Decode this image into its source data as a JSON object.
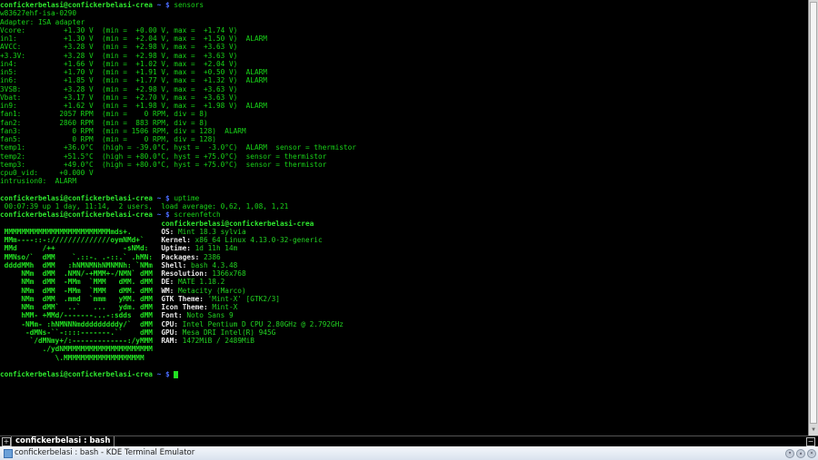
{
  "prompt": {
    "user_host": "confickerbelasi@confickerbelasi-crea",
    "tilde_dollar": " ~ $ "
  },
  "commands": [
    "sensors",
    "uptime",
    "screenfetch"
  ],
  "sensors_output": [
    "w83627ehf-isa-0290",
    "Adapter: ISA adapter",
    "Vcore:         +1.30 V  (min =  +0.00 V, max =  +1.74 V)",
    "in1:           +1.30 V  (min =  +2.04 V, max =  +1.50 V)  ALARM",
    "AVCC:          +3.28 V  (min =  +2.98 V, max =  +3.63 V)",
    "+3.3V:         +3.28 V  (min =  +2.98 V, max =  +3.63 V)",
    "in4:           +1.66 V  (min =  +1.02 V, max =  +2.04 V)",
    "in5:           +1.70 V  (min =  +1.91 V, max =  +0.50 V)  ALARM",
    "in6:           +1.85 V  (min =  +1.77 V, max =  +1.32 V)  ALARM",
    "3VSB:          +3.28 V  (min =  +2.98 V, max =  +3.63 V)",
    "Vbat:          +3.17 V  (min =  +2.70 V, max =  +3.63 V)",
    "in9:           +1.62 V  (min =  +1.98 V, max =  +1.98 V)  ALARM",
    "fan1:         2057 RPM  (min =    0 RPM, div = 8)",
    "fan2:         2860 RPM  (min =  883 RPM, div = 8)",
    "fan3:            0 RPM  (min = 1506 RPM, div = 128)  ALARM",
    "fan5:            0 RPM  (min =    0 RPM, div = 128)",
    "temp1:         +36.0°C  (high = -39.0°C, hyst =  -3.0°C)  ALARM  sensor = thermistor",
    "temp2:         +51.5°C  (high = +80.0°C, hyst = +75.0°C)  sensor = thermistor",
    "temp3:         +49.0°C  (high = +80.0°C, hyst = +75.0°C)  sensor = thermistor",
    "cpu0_vid:     +0.000 V",
    "intrusion0:  ALARM",
    ""
  ],
  "uptime_output": " 00:07:39 up 1 day, 11:14,  2 users,  load average: 0,62, 1,08, 1,21",
  "screenfetch": {
    "art": [
      "                                    ",
      " MMMMMMMMMMMMMMMMMMMMMMMMMmds+.     ",
      " MMm----::-://////////////oymNMd+`  ",
      " MMd      /++                -sNMd: ",
      " MMNso/`  dMM    `.::-. .-::.` .hMN:",
      " ddddMMh  dMM   :hNMNMNhNMNMNh: `NMm",
      "     NMm  dMM  .NMN/-+MMM+-/NMN` dMM",
      "     NMm  dMM  -MMm  `MMM   dMM. dMM",
      "     NMm  dMM  -MMm  `MMM   dMM. dMM",
      "     NMm  dMM  .mmd  `mmm   yMM. dMM",
      "     NMm  dMM`  ..`   ...   ydm. dMM",
      "     hMM- +MMd/-------...-:sdds  dMM",
      "     -NMm- :hNMNNNmdddddddddy/`  dMM",
      "      -dMNs-``-::::-------.``    dMM",
      "       `/dMNmy+/:-------------:/yMMM",
      "          ./ydNMMMMMMMMMMMMMMMMMMMMM",
      "             \\.MMMMMMMMMMMMMMMMMMM   "
    ],
    "header": "confickerbelasi@confickerbelasi-crea",
    "info": [
      {
        "label": "OS:",
        "value": "Mint 18.3 sylvia"
      },
      {
        "label": "Kernel:",
        "value": "x86_64 Linux 4.13.0-32-generic"
      },
      {
        "label": "Uptime:",
        "value": "1d 11h 14m"
      },
      {
        "label": "Packages:",
        "value": "2386"
      },
      {
        "label": "Shell:",
        "value": "bash 4.3.48"
      },
      {
        "label": "Resolution:",
        "value": "1366x768"
      },
      {
        "label": "DE:",
        "value": "MATE 1.18.2"
      },
      {
        "label": "WM:",
        "value": "Metacity (Marco)"
      },
      {
        "label": "GTK Theme:",
        "value": "'Mint-X' [GTK2/3]"
      },
      {
        "label": "Icon Theme:",
        "value": "Mint-X"
      },
      {
        "label": "Font:",
        "value": "Noto Sans 9"
      },
      {
        "label": "CPU:",
        "value": "Intel Pentium D CPU 2.80GHz @ 2.792GHz"
      },
      {
        "label": "GPU:",
        "value": "Mesa DRI Intel(R) 945G"
      },
      {
        "label": "RAM:",
        "value": "1472MiB / 2489MiB"
      }
    ]
  },
  "tab": {
    "label": "confickerbelasi : bash",
    "new_tab": "+",
    "close": "−"
  },
  "window": {
    "title": "confickerbelasi : bash - KDE Terminal Emulator"
  }
}
